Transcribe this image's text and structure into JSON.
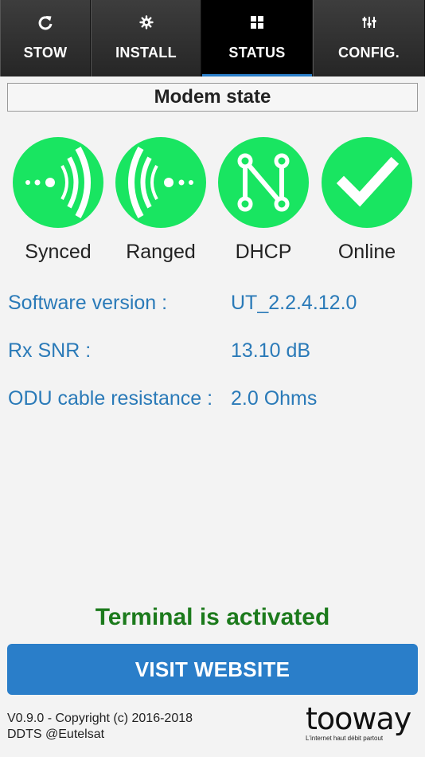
{
  "tabs": [
    {
      "label": "STOW",
      "icon": "refresh-icon",
      "active": false
    },
    {
      "label": "INSTALL",
      "icon": "gear-icon",
      "active": false
    },
    {
      "label": "STATUS",
      "icon": "grid-icon",
      "active": true
    },
    {
      "label": "CONFIG.",
      "icon": "sliders-icon",
      "active": false
    }
  ],
  "section_title": "Modem state",
  "states": [
    {
      "label": "Synced",
      "icon": "synced-signal-icon"
    },
    {
      "label": "Ranged",
      "icon": "ranged-signal-icon"
    },
    {
      "label": "DHCP",
      "icon": "dhcp-network-icon"
    },
    {
      "label": "Online",
      "icon": "checkmark-icon"
    }
  ],
  "info": [
    {
      "key": "Software version :",
      "value": "UT_2.2.4.12.0"
    },
    {
      "key": "Rx SNR :",
      "value": "13.10 dB"
    },
    {
      "key": "ODU cable resistance :",
      "value": "2.0 Ohms"
    }
  ],
  "status_message": "Terminal is activated",
  "visit_button": "VISIT WEBSITE",
  "footer": {
    "line1": "V0.9.0 - Copyright (c) 2016-2018",
    "line2": "DDTS @Eutelsat"
  },
  "logo": {
    "word": "tooway",
    "tagline": "L'internet haut débit partout"
  },
  "colors": {
    "accent": "#2a7ec9",
    "state_green": "#19e561",
    "info_text": "#2a7ab8",
    "activated_text": "#1c7a1c"
  }
}
